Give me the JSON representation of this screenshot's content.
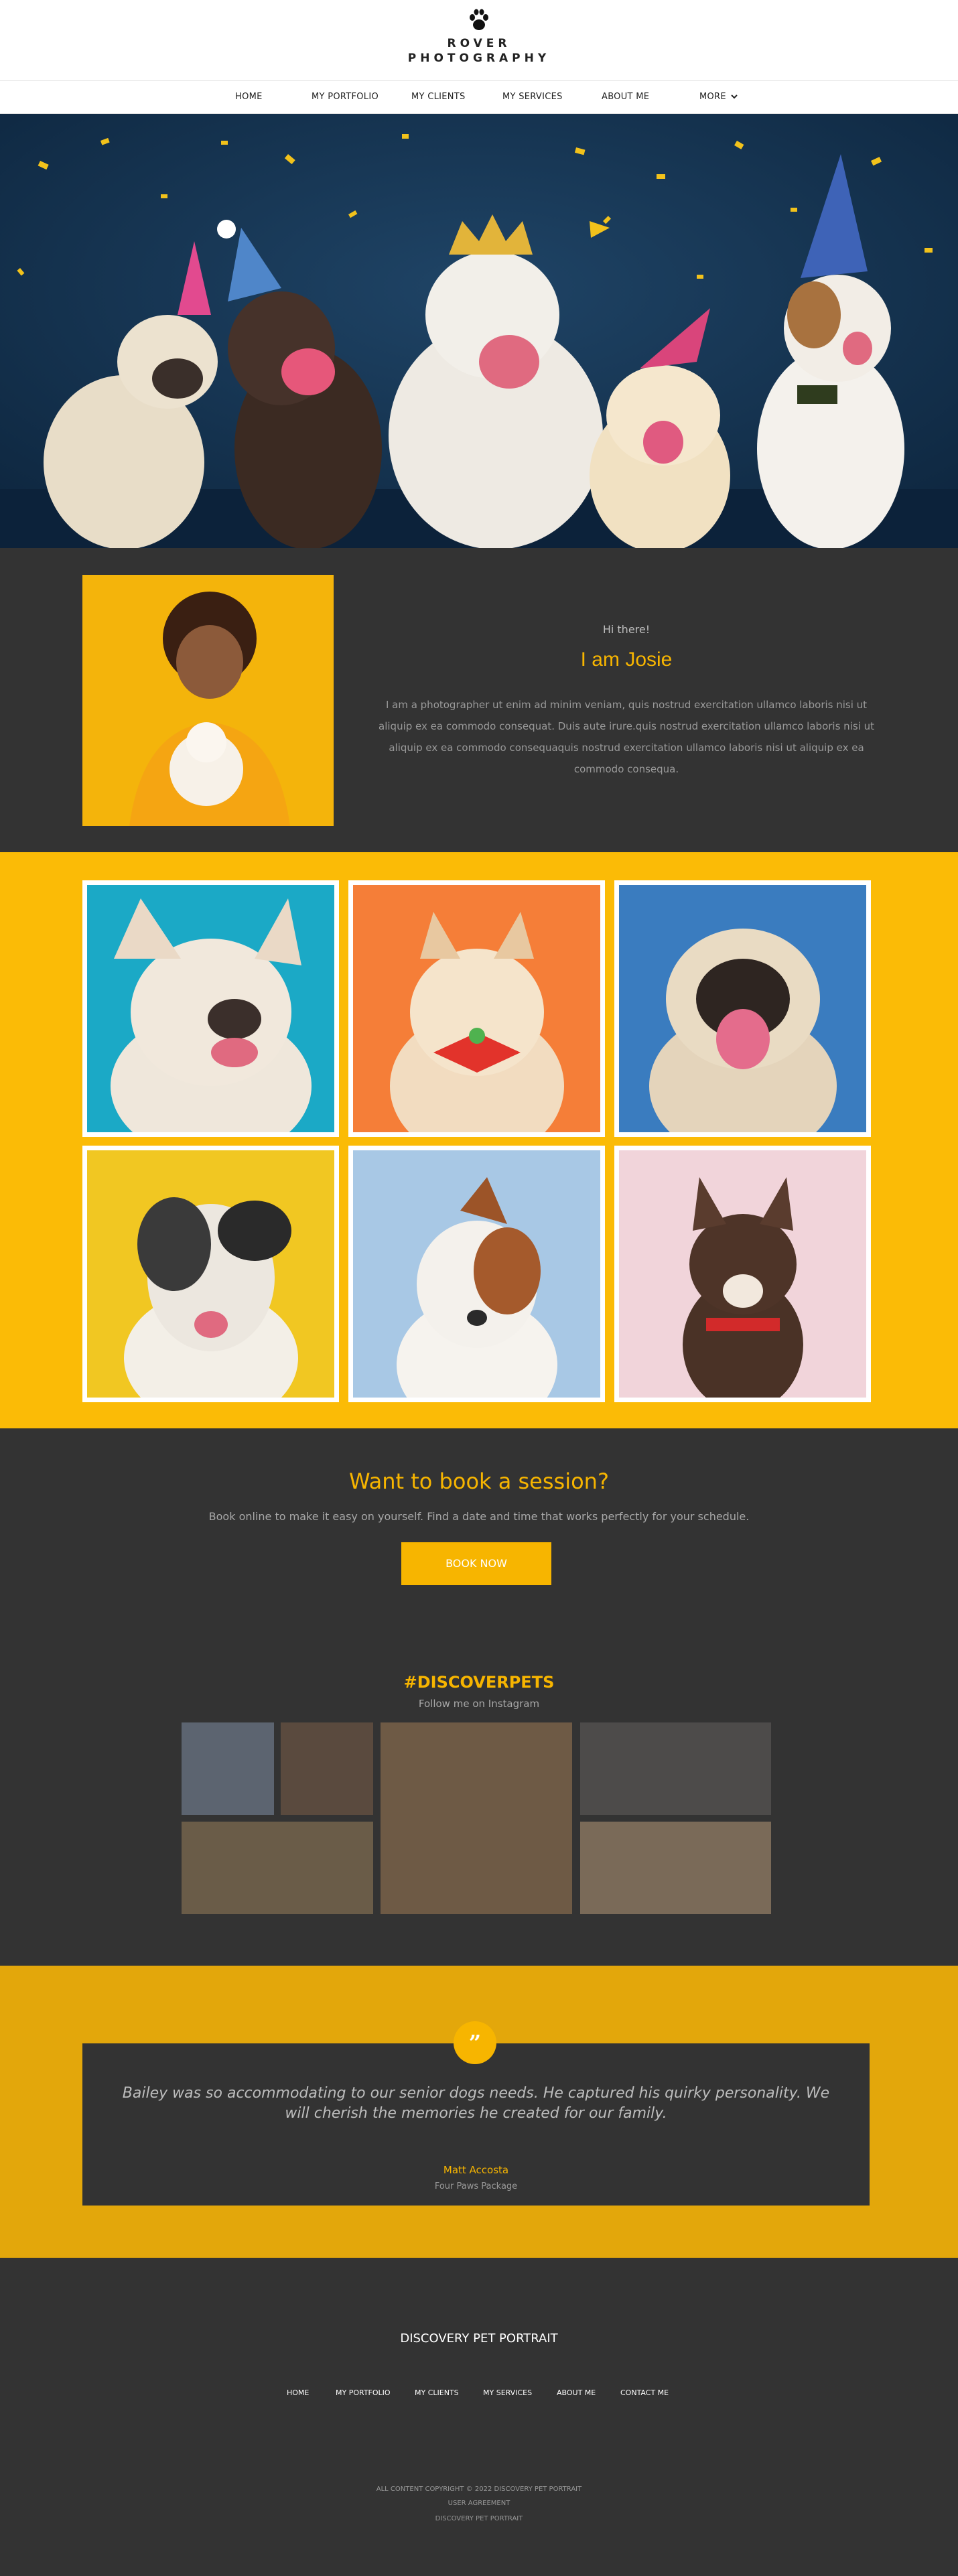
{
  "brand": {
    "line1": "ROVER",
    "line2": "PHOTOGRAPHY"
  },
  "nav": {
    "items": [
      "HOME",
      "MY PORTFOLIO",
      "MY CLIENTS",
      "MY SERVICES",
      "ABOUT ME",
      "MORE"
    ]
  },
  "about": {
    "greeting": "Hi there!",
    "name": "I am Josie",
    "bio": "I am a photographer ut enim ad minim veniam, quis nostrud exercitation ullamco laboris nisi ut aliquip ex ea commodo consequat. Duis aute irure.quis nostrud exercitation ullamco laboris nisi ut aliquip ex ea commodo consequaquis nostrud exercitation ullamco laboris nisi ut aliquip ex ea commodo consequa."
  },
  "book": {
    "title": "Want to book a session?",
    "subtitle": "Book online to make it easy on yourself. Find a date and time that works perfectly for your schedule.",
    "button": "BOOK NOW"
  },
  "instagram": {
    "hashtag": "#DISCOVERPETS",
    "follow": "Follow me on Instagram"
  },
  "testimonial": {
    "quote_mark": "”",
    "quote": "Bailey was so accommodating to our senior dogs needs. He captured his quirky personality. We will cherish the memories he created for our family.",
    "author": "Matt Accosta",
    "package": "Four Paws Package"
  },
  "footer": {
    "brand": "DISCOVERY PET PORTRAIT",
    "links": [
      "HOME",
      "MY PORTFOLIO",
      "MY CLIENTS",
      "MY SERVICES",
      "ABOUT ME",
      "CONTACT ME"
    ],
    "copyright": "ALL CONTENT COPYRIGHT © 2022 DISCOVERY PET PORTRAIT",
    "user_agreement": "USER AGREEMENT",
    "site": "DISCOVERY PET PORTRAIT"
  },
  "colors": {
    "accent": "#f7b500",
    "dark": "#333333",
    "gallery_bg": "#fbbb06",
    "hero_bg": "#12324f"
  },
  "icons": {
    "logo": "paw-print-icon",
    "more": "chevron-down-icon",
    "quote": "quote-icon"
  }
}
